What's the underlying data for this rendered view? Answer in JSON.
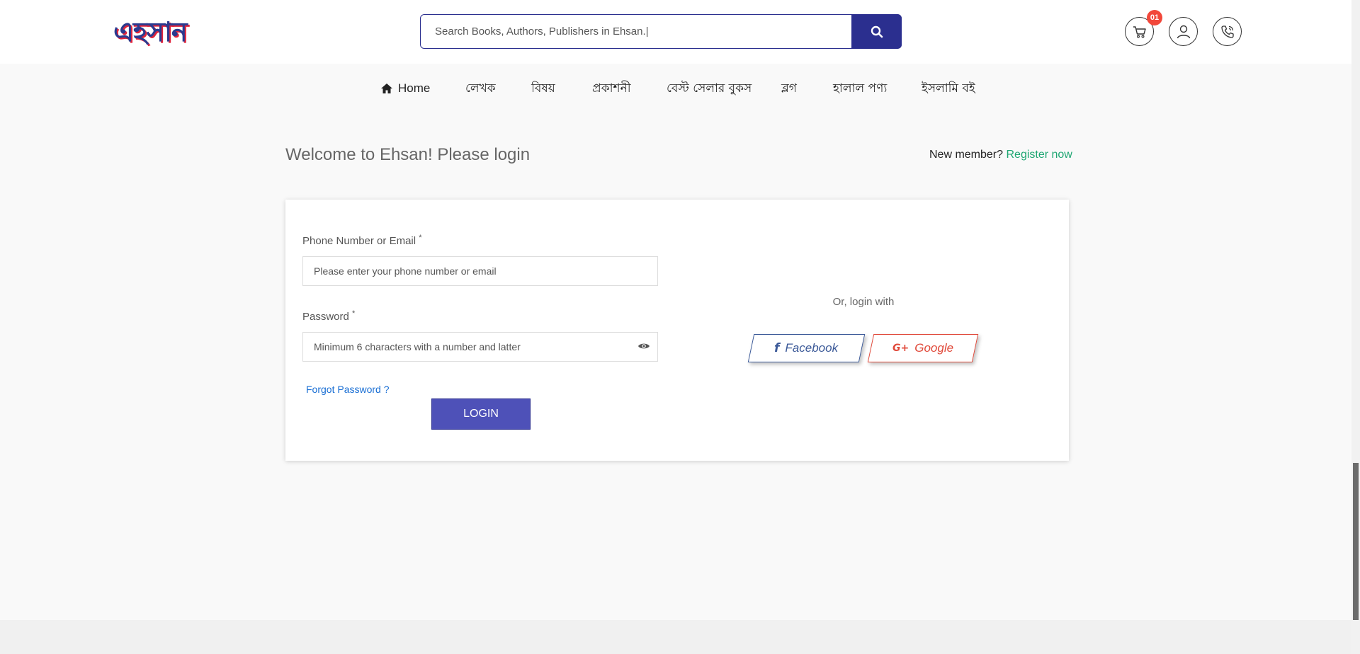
{
  "brand": {
    "logo_text": "এহসান"
  },
  "search": {
    "placeholder": "Search Books, Authors, Publishers in Ehsan.|"
  },
  "cart": {
    "badge": "01"
  },
  "nav": {
    "home": "Home",
    "items": [
      "লেখক",
      "বিষয়",
      "প্রকাশনী",
      "বেস্ট সেলার বুকস",
      "ব্লগ",
      "হালাল পণ্য",
      "ইসলামি বই"
    ]
  },
  "page": {
    "title": "Welcome to Ehsan! Please login",
    "new_member": "New member?",
    "register": "Register now"
  },
  "form": {
    "phone_label": "Phone Number or Email",
    "phone_placeholder": "Please enter your phone number or email",
    "password_label": "Password",
    "password_placeholder": "Minimum 6 characters with a number and latter",
    "required_mark": "*",
    "forgot": "Forgot Password ?",
    "login": "LOGIN"
  },
  "social": {
    "or_text": "Or, login with",
    "facebook": "Facebook",
    "facebook_glyph": "f",
    "google": "Google",
    "google_glyph": "G+"
  },
  "colors": {
    "primary": "#2b2f8f",
    "login_button": "#4e51b8",
    "register_link": "#1ea672",
    "forgot_link": "#1a6fd4",
    "facebook": "#3b5998",
    "google": "#e0493a",
    "badge": "#f2473a"
  }
}
